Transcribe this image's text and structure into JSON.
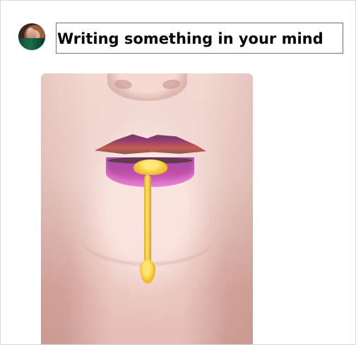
{
  "composer": {
    "avatar_icon": "user-avatar",
    "input_value": "Writing something in your mind"
  },
  "media": {
    "image_type": "close-up lips with honey drip"
  },
  "colors": {
    "background": "#ffffff",
    "input_border": "#707070",
    "text": "#000000",
    "lip_purple": "#9d4ea3",
    "honey_yellow": "#f4c43b"
  }
}
